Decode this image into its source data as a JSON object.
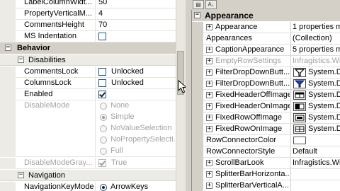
{
  "left_grid": {
    "top_rows": [
      {
        "name": "LabelColumnWidt...",
        "value": "50"
      },
      {
        "name": "PropertyVerticalM...",
        "value": "4"
      },
      {
        "name": "CommentsHeight",
        "value": "70"
      },
      {
        "name": "MS Indentation",
        "checked": false
      }
    ],
    "behavior_category": "Behavior",
    "disabilities_label": "Disabilities",
    "comments_lock": {
      "name": "CommentsLock",
      "label": "Unlocked",
      "checked": false
    },
    "columns_lock": {
      "name": "ColumnsLock",
      "label": "Unlocked",
      "checked": false
    },
    "enabled": {
      "name": "Enabled",
      "checked": true
    },
    "disable_mode": {
      "name": "DisableMode",
      "options": [
        "None",
        "Simple",
        "NoValueSelection",
        "NoPropertySelecti...",
        "Full"
      ],
      "selected": "Simple"
    },
    "disable_mode_gray": {
      "name": "DisableModeGray...",
      "label": "True",
      "checked": true
    },
    "navigation_label": "Navigation",
    "navigation_key_mode": {
      "name": "NavigationKeyMode",
      "value": "ArrowKeys"
    }
  },
  "right_grid": {
    "category": "Appearance",
    "rows": [
      {
        "name": "Appearance",
        "value": "1 properties mo",
        "expand": true,
        "disabled": false
      },
      {
        "name": "Appearances",
        "value": "(Collection)",
        "expand": false,
        "disabled": false
      },
      {
        "name": "CaptionAppearance",
        "value": "5 properties mo",
        "expand": true,
        "disabled": false
      },
      {
        "name": "EmptyRowSettings",
        "value": "Infragistics.Wi",
        "expand": true,
        "disabled": true
      },
      {
        "name": "FilterDropDownButt...",
        "value": "System.D",
        "expand": true,
        "disabled": false,
        "icon": "filter-icon"
      },
      {
        "name": "FilterDropDownButt...",
        "value": "System.D",
        "expand": true,
        "disabled": false,
        "icon": "filter-active-icon"
      },
      {
        "name": "FixedHeaderOffImage",
        "value": "System.D",
        "expand": true,
        "disabled": false,
        "icon": "fixed-header-off-icon"
      },
      {
        "name": "FixedHeaderOnImage",
        "value": "System.D",
        "expand": true,
        "disabled": false,
        "icon": "fixed-header-on-icon"
      },
      {
        "name": "FixedRowOffImage",
        "value": "System.D",
        "expand": true,
        "disabled": false,
        "icon": "fixed-row-off-icon"
      },
      {
        "name": "FixedRowOnImage",
        "value": "System.D",
        "expand": true,
        "disabled": false,
        "icon": "fixed-row-on-icon"
      },
      {
        "name": "RowConnectorColor",
        "value": "",
        "expand": false,
        "disabled": false,
        "color": "#ffffff"
      },
      {
        "name": "RowConnectorStyle",
        "value": "Default",
        "expand": false,
        "disabled": false
      },
      {
        "name": "ScrollBarLook",
        "value": "Infragistics.Win",
        "expand": true,
        "disabled": false
      },
      {
        "name": "SplitterBarHorizonta...",
        "value": "",
        "expand": true,
        "disabled": false
      },
      {
        "name": "SplitterBarVerticalA...",
        "value": "",
        "expand": true,
        "disabled": false
      }
    ]
  },
  "colors": {
    "accent_blue": "#1c5180",
    "chrome": "#d4d0c8",
    "disabled_text": "#a3a3a3"
  }
}
